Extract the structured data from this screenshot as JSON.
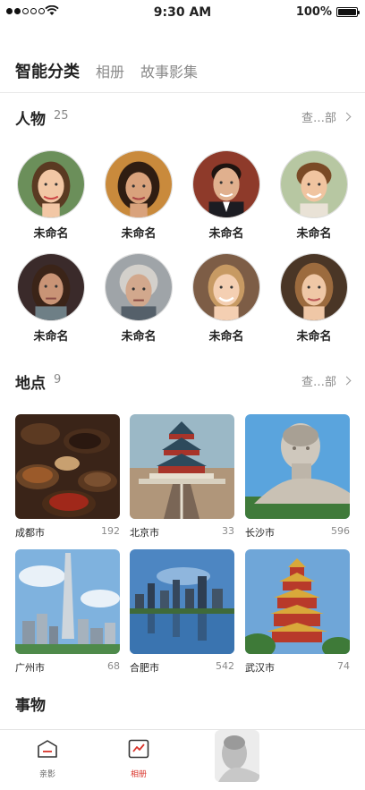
{
  "status_bar": {
    "time": "9:30 AM",
    "battery": "100%"
  },
  "tabs": [
    {
      "label": "智能分类",
      "active": true
    },
    {
      "label": "相册",
      "active": false
    },
    {
      "label": "故事影集",
      "active": false
    }
  ],
  "people_section": {
    "title": "人物",
    "count": "25",
    "see_all": "查…部",
    "people": [
      {
        "name": "未命名",
        "icon": "portrait-woman"
      },
      {
        "name": "未命名",
        "icon": "portrait-woman"
      },
      {
        "name": "未命名",
        "icon": "portrait-man"
      },
      {
        "name": "未命名",
        "icon": "portrait-boy"
      },
      {
        "name": "未命名",
        "icon": "portrait-woman"
      },
      {
        "name": "未命名",
        "icon": "portrait-elderly-woman"
      },
      {
        "name": "未命名",
        "icon": "portrait-girl"
      },
      {
        "name": "未命名",
        "icon": "portrait-girl"
      }
    ]
  },
  "places_section": {
    "title": "地点",
    "count": "9",
    "see_all": "查…部",
    "places": [
      {
        "name": "成都市",
        "count": "192",
        "icon": "spices-photo"
      },
      {
        "name": "北京市",
        "count": "33",
        "icon": "temple-of-heaven-photo"
      },
      {
        "name": "长沙市",
        "count": "596",
        "icon": "statue-photo"
      },
      {
        "name": "广州市",
        "count": "68",
        "icon": "canton-tower-photo"
      },
      {
        "name": "合肥市",
        "count": "542",
        "icon": "city-skyline-photo"
      },
      {
        "name": "武汉市",
        "count": "74",
        "icon": "yellow-crane-tower-photo"
      }
    ]
  },
  "things_section": {
    "title": "事物"
  },
  "bottom_nav": {
    "items": [
      {
        "label": "亲影",
        "icon": "home-icon",
        "active": false
      },
      {
        "label": "相册",
        "icon": "album-icon",
        "active": true
      }
    ],
    "accent_color": "#d9342b"
  }
}
